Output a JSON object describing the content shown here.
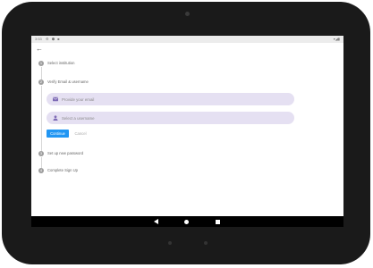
{
  "status_bar": {
    "time": "3:53",
    "icons": "⚙ ⬢ ■",
    "right_icons": "▾◢▮"
  },
  "steps": [
    {
      "number": "1",
      "label": "Select institution"
    },
    {
      "number": "2",
      "label": "Verify Email & username"
    },
    {
      "number": "3",
      "label": "Set up new password"
    },
    {
      "number": "4",
      "label": "Complete Sign Up"
    }
  ],
  "form": {
    "email_placeholder": "Provide your email",
    "username_placeholder": "Select a username",
    "continue_label": "Continue",
    "cancel_label": "Cancel"
  },
  "colors": {
    "primary": "#2196f3",
    "field_bg": "#e5e0f2",
    "field_icon": "#7e6bb5",
    "step_inactive": "#9e9e9e"
  },
  "nav_icons": [
    "back-triangle",
    "home-circle",
    "recents-square"
  ]
}
